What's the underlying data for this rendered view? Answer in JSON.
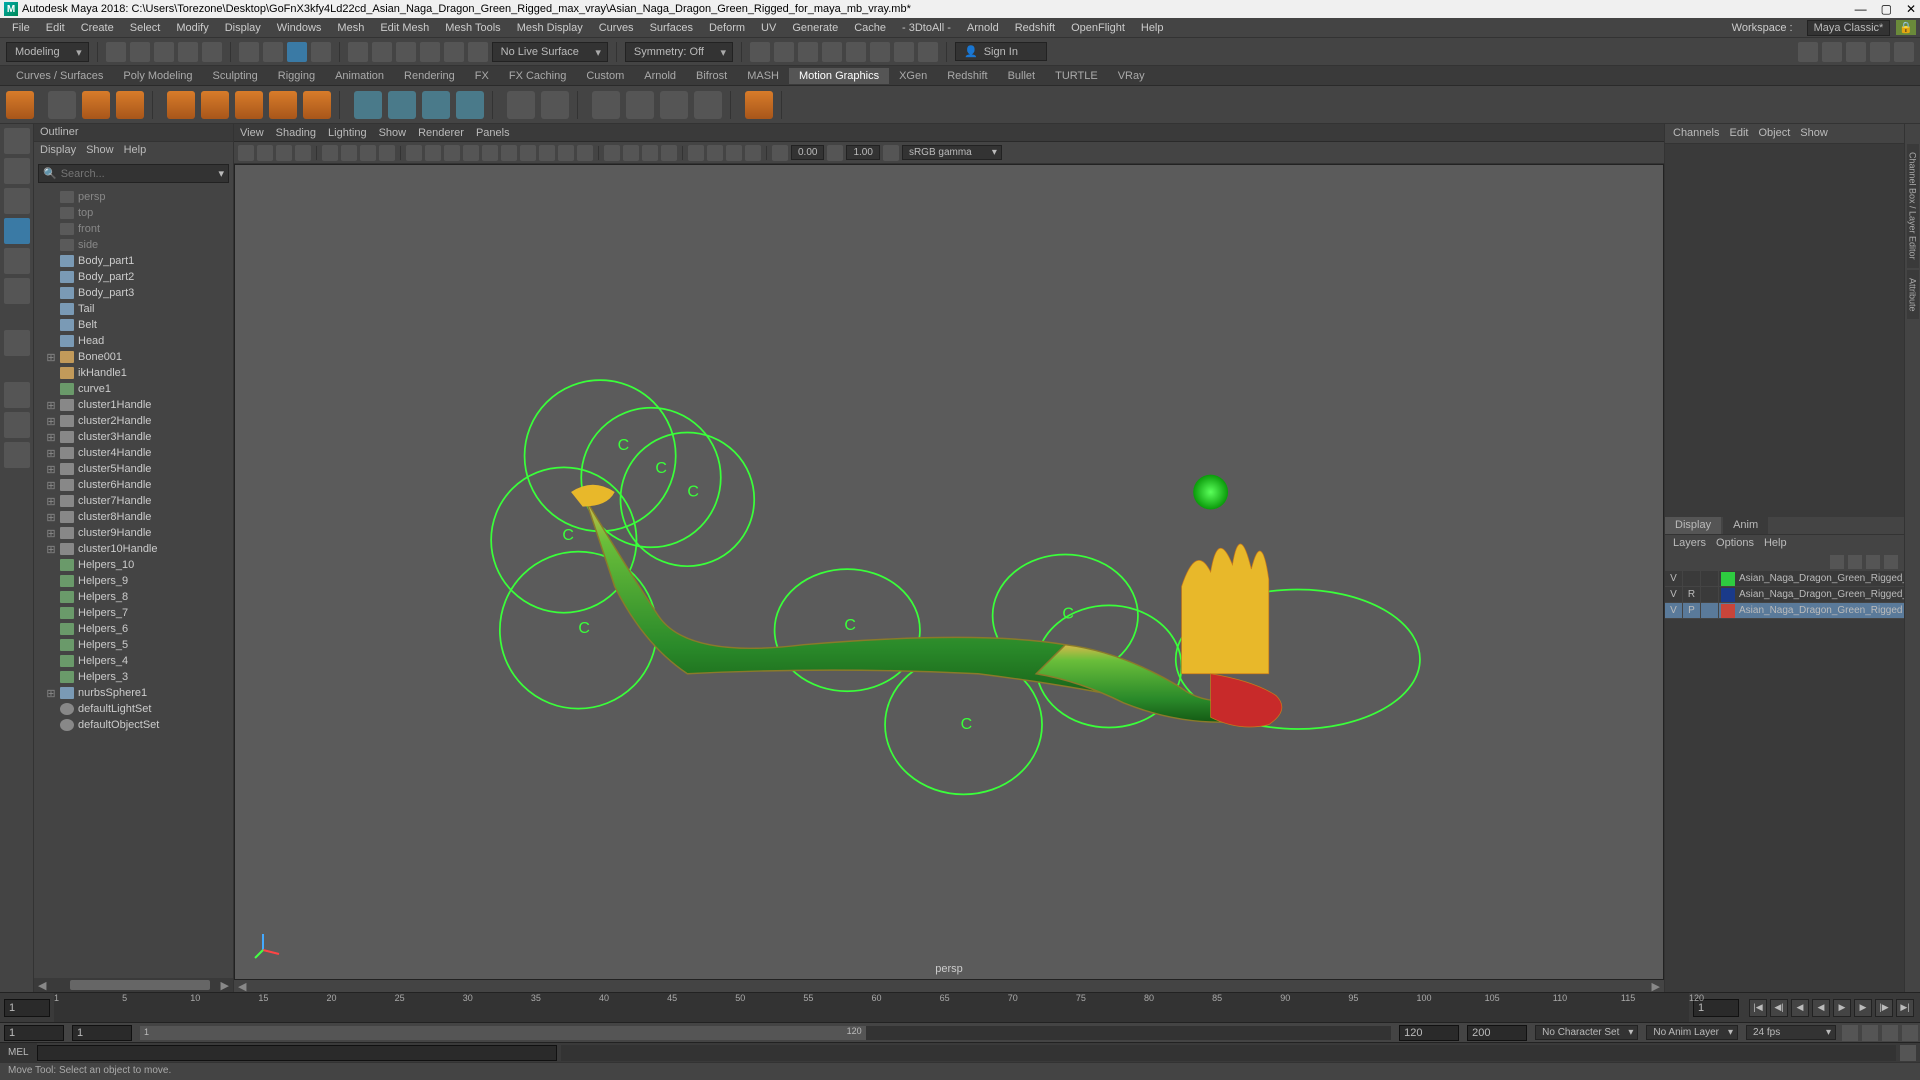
{
  "title": "Autodesk Maya 2018: C:\\Users\\Torezone\\Desktop\\GoFnX3kfy4Ld22cd_Asian_Naga_Dragon_Green_Rigged_max_vray\\Asian_Naga_Dragon_Green_Rigged_for_maya_mb_vray.mb*",
  "menubar": [
    "File",
    "Edit",
    "Create",
    "Select",
    "Modify",
    "Display",
    "Windows",
    "Mesh",
    "Edit Mesh",
    "Mesh Tools",
    "Mesh Display",
    "Curves",
    "Surfaces",
    "Deform",
    "UV",
    "Generate",
    "Cache",
    "- 3DtoAll -",
    "Arnold",
    "Redshift",
    "OpenFlight",
    "Help"
  ],
  "workspace_label": "Workspace :",
  "workspace_value": "Maya Classic*",
  "module_dd": "Modeling",
  "live_surface": "No Live Surface",
  "symmetry": "Symmetry: Off",
  "signin": "Sign In",
  "shelf_tabs": [
    "Curves / Surfaces",
    "Poly Modeling",
    "Sculpting",
    "Rigging",
    "Animation",
    "Rendering",
    "FX",
    "FX Caching",
    "Custom",
    "Arnold",
    "Bifrost",
    "MASH",
    "Motion Graphics",
    "XGen",
    "Redshift",
    "Bullet",
    "TURTLE",
    "VRay"
  ],
  "shelf_active": "Motion Graphics",
  "outliner": {
    "title": "Outliner",
    "menus": [
      "Display",
      "Show",
      "Help"
    ],
    "search_placeholder": "Search...",
    "items": [
      {
        "icon": "cam",
        "label": "persp",
        "dim": true
      },
      {
        "icon": "cam",
        "label": "top",
        "dim": true
      },
      {
        "icon": "cam",
        "label": "front",
        "dim": true
      },
      {
        "icon": "cam",
        "label": "side",
        "dim": true
      },
      {
        "icon": "mesh",
        "label": "Body_part1"
      },
      {
        "icon": "mesh",
        "label": "Body_part2"
      },
      {
        "icon": "mesh",
        "label": "Body_part3"
      },
      {
        "icon": "mesh",
        "label": "Tail"
      },
      {
        "icon": "mesh",
        "label": "Belt"
      },
      {
        "icon": "mesh",
        "label": "Head"
      },
      {
        "icon": "bone",
        "label": "Bone001",
        "exp": true
      },
      {
        "icon": "bone",
        "label": "ikHandle1"
      },
      {
        "icon": "curve",
        "label": "curve1"
      },
      {
        "icon": "cluster",
        "label": "cluster1Handle",
        "exp": true
      },
      {
        "icon": "cluster",
        "label": "cluster2Handle",
        "exp": true
      },
      {
        "icon": "cluster",
        "label": "cluster3Handle",
        "exp": true
      },
      {
        "icon": "cluster",
        "label": "cluster4Handle",
        "exp": true
      },
      {
        "icon": "cluster",
        "label": "cluster5Handle",
        "exp": true
      },
      {
        "icon": "cluster",
        "label": "cluster6Handle",
        "exp": true
      },
      {
        "icon": "cluster",
        "label": "cluster7Handle",
        "exp": true
      },
      {
        "icon": "cluster",
        "label": "cluster8Handle",
        "exp": true
      },
      {
        "icon": "cluster",
        "label": "cluster9Handle",
        "exp": true
      },
      {
        "icon": "cluster",
        "label": "cluster10Handle",
        "exp": true
      },
      {
        "icon": "curve",
        "label": "Helpers_10"
      },
      {
        "icon": "curve",
        "label": "Helpers_9"
      },
      {
        "icon": "curve",
        "label": "Helpers_8"
      },
      {
        "icon": "curve",
        "label": "Helpers_7"
      },
      {
        "icon": "curve",
        "label": "Helpers_6"
      },
      {
        "icon": "curve",
        "label": "Helpers_5"
      },
      {
        "icon": "curve",
        "label": "Helpers_4"
      },
      {
        "icon": "curve",
        "label": "Helpers_3"
      },
      {
        "icon": "mesh",
        "label": "nurbsSphere1",
        "exp": true
      },
      {
        "icon": "set",
        "label": "defaultLightSet"
      },
      {
        "icon": "set",
        "label": "defaultObjectSet"
      }
    ]
  },
  "viewport": {
    "menus": [
      "View",
      "Shading",
      "Lighting",
      "Show",
      "Renderer",
      "Panels"
    ],
    "exposure": "0.00",
    "gamma": "1.00",
    "colorspace": "sRGB gamma",
    "label": "persp"
  },
  "channelbox": {
    "menus": [
      "Channels",
      "Edit",
      "Object",
      "Show"
    ],
    "tabs": [
      "Display",
      "Anim"
    ],
    "layer_menus": [
      "Layers",
      "Options",
      "Help"
    ],
    "layers": [
      {
        "v": "V",
        "p": "",
        "swatch": "#2ecc40",
        "name": "Asian_Naga_Dragon_Green_Rigged_Helpe",
        "sel": false
      },
      {
        "v": "V",
        "p": "R",
        "swatch": "#1a3a8a",
        "name": "Asian_Naga_Dragon_Green_Rigged_bones",
        "sel": false
      },
      {
        "v": "V",
        "p": "P",
        "swatch": "#c8453a",
        "name": "Asian_Naga_Dragon_Green_Rigged",
        "sel": true
      }
    ]
  },
  "timeline": {
    "current": "1",
    "ticks": [
      "1",
      "5",
      "10",
      "15",
      "20",
      "25",
      "30",
      "35",
      "40",
      "45",
      "50",
      "55",
      "60",
      "65",
      "70",
      "75",
      "80",
      "85",
      "90",
      "95",
      "100",
      "105",
      "110",
      "115",
      "120"
    ],
    "range_current": "1"
  },
  "range": {
    "start_outer": "1",
    "start_inner": "1",
    "inner_label": "1",
    "end_inner": "120",
    "end_outer": "120",
    "end_label": "200",
    "char_set": "No Character Set",
    "anim_layer": "No Anim Layer",
    "fps": "24 fps"
  },
  "cmd": {
    "lang": "MEL"
  },
  "helpline": "Move Tool: Select an object to move."
}
